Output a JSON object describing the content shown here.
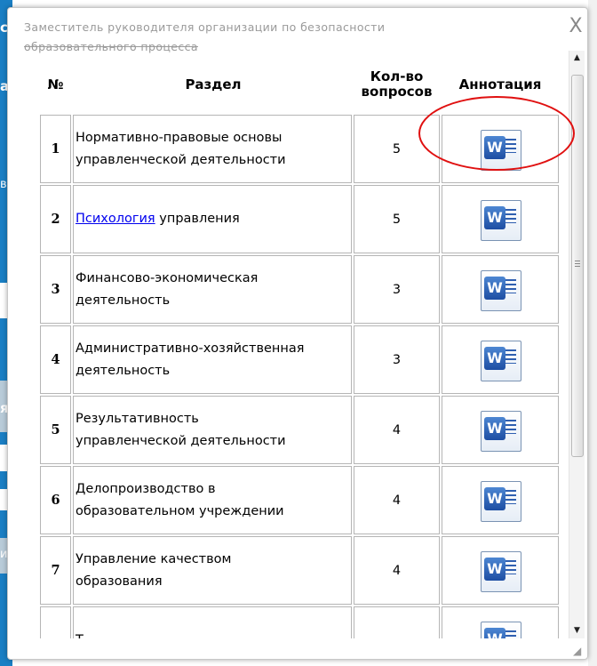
{
  "dialog": {
    "title_line1": "Заместитель руководителя организации по безопасности",
    "title_line2": "образовательного процесса",
    "close_glyph": "X"
  },
  "table": {
    "headers": {
      "num": "№",
      "section": "Раздел",
      "count_line1": "Кол-во",
      "count_line2": "вопросов",
      "annotation": "Аннотация"
    },
    "rows": [
      {
        "num": "1",
        "section_line1": "Нормативно-правовые основы",
        "section_line2": "управленческой деятельности",
        "count": "5"
      },
      {
        "num": "2",
        "link": "Психология",
        "section_rest": " управления",
        "count": "5"
      },
      {
        "num": "3",
        "section_line1": "Финансово-экономическая",
        "section_line2": "деятельность",
        "count": "3"
      },
      {
        "num": "4",
        "section_line1": "Административно-хозяйственная",
        "section_line2": "деятельность",
        "count": "3"
      },
      {
        "num": "5",
        "section_line1": "Результативность",
        "section_line2": "управленческой деятельности",
        "count": "4"
      },
      {
        "num": "6",
        "section_line1": "Делопроизводство в",
        "section_line2": "образовательном учреждении",
        "count": "4"
      },
      {
        "num": "7",
        "section_line1": "Управление качеством",
        "section_line2": "образования",
        "count": "4"
      },
      {
        "num": "",
        "section_line1": "Т",
        "count": ""
      }
    ],
    "annotation_icon": "word-document-icon",
    "word_letter": "W"
  },
  "background": {
    "chars": [
      "с",
      "а:",
      "ве",
      "я",
      "и"
    ]
  },
  "colors": {
    "accent_blue": "#1a7fc4",
    "highlight_oval": "#e01010",
    "link": "#0000ee"
  }
}
